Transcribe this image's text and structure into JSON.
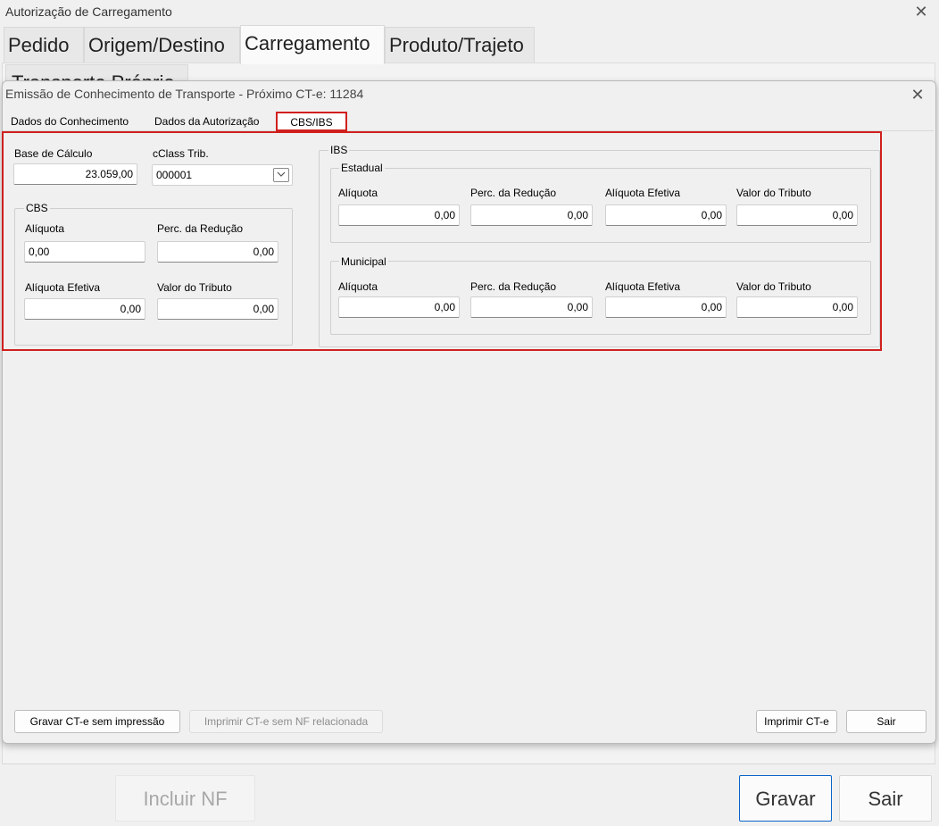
{
  "outer": {
    "title": "Autorização de Carregamento",
    "tabs": [
      "Pedido",
      "Origem/Destino",
      "Carregamento",
      "Produto/Trajeto"
    ],
    "hidden_tab": "Transporte Próprio",
    "buttons": {
      "incluir": "Incluir NF",
      "gravar": "Gravar",
      "sair": "Sair"
    }
  },
  "dialog": {
    "title": "Emissão de Conhecimento de Transporte - Próximo CT-e: 11284",
    "tabs": [
      "Dados do Conhecimento",
      "Dados da Autorização",
      "CBS/IBS"
    ],
    "base_calculo": {
      "label": "Base de Cálculo",
      "value": "23.059,00"
    },
    "cclass": {
      "label": "cClass Trib.",
      "value": "000001"
    },
    "cbs": {
      "title": "CBS",
      "aliquota": {
        "label": "Alíquota",
        "value": "0,00"
      },
      "perc_reducao": {
        "label": "Perc. da Redução",
        "value": "0,00"
      },
      "aliquota_efetiva": {
        "label": "Alíquota Efetiva",
        "value": "0,00"
      },
      "valor_tributo": {
        "label": "Valor do Tributo",
        "value": "0,00"
      }
    },
    "ibs": {
      "title": "IBS",
      "estadual": {
        "title": "Estadual",
        "aliquota": {
          "label": "Alíquota",
          "value": "0,00"
        },
        "perc_reducao": {
          "label": "Perc. da Redução",
          "value": "0,00"
        },
        "aliquota_efetiva": {
          "label": "Alíquota Efetiva",
          "value": "0,00"
        },
        "valor_tributo": {
          "label": "Valor do Tributo",
          "value": "0,00"
        }
      },
      "municipal": {
        "title": "Municipal",
        "aliquota": {
          "label": "Alíquota",
          "value": "0,00"
        },
        "perc_reducao": {
          "label": "Perc. da Redução",
          "value": "0,00"
        },
        "aliquota_efetiva": {
          "label": "Alíquota Efetiva",
          "value": "0,00"
        },
        "valor_tributo": {
          "label": "Valor do Tributo",
          "value": "0,00"
        }
      }
    },
    "buttons": {
      "gravar_sem_impressao": "Gravar CT-e sem impressão",
      "imprimir_sem_nf": "Imprimir CT-e sem NF relacionada",
      "imprimir": "Imprimir CT-e",
      "sair": "Sair"
    }
  },
  "icons": {
    "close": "close-icon",
    "dropdown": "chevron-down-icon"
  },
  "colors": {
    "highlight": "#d0201e",
    "focus": "#0a64c8"
  }
}
